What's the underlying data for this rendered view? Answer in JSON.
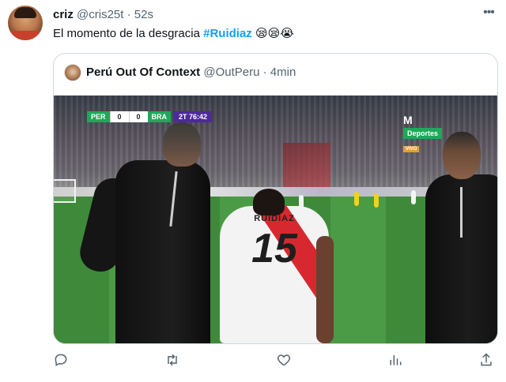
{
  "tweet": {
    "display_name": "criz",
    "handle": "@cris25t",
    "separator": "·",
    "time": "52s",
    "text": "El momento de la desgracia ",
    "hashtag": "#Ruidiaz",
    "emojis": "😪😪😭"
  },
  "quoted_tweet": {
    "display_name": "Perú Out Of Context",
    "handle": "@OutPeru",
    "separator": "·",
    "time": "4min",
    "media": {
      "scoreboard": {
        "home_team": "PER",
        "home_score": "0",
        "away_score": "0",
        "away_team": "BRA",
        "period_time": "2T 76:42"
      },
      "broadcaster": {
        "logo_glyph": "M",
        "label": "Deportes",
        "live_tag": "VIVO"
      },
      "shirt_name": "RUIDIAZ",
      "shirt_number": "15"
    }
  },
  "actions": [
    {
      "name": "reply",
      "icon": "reply-icon"
    },
    {
      "name": "retweet",
      "icon": "retweet-icon"
    },
    {
      "name": "like",
      "icon": "heart-icon"
    },
    {
      "name": "views",
      "icon": "analytics-icon"
    },
    {
      "name": "share",
      "icon": "share-icon"
    }
  ],
  "colors": {
    "link": "#1d9bf0",
    "secondary_text": "#536471",
    "border": "#cfd9de",
    "primary_text": "#0f1419"
  }
}
